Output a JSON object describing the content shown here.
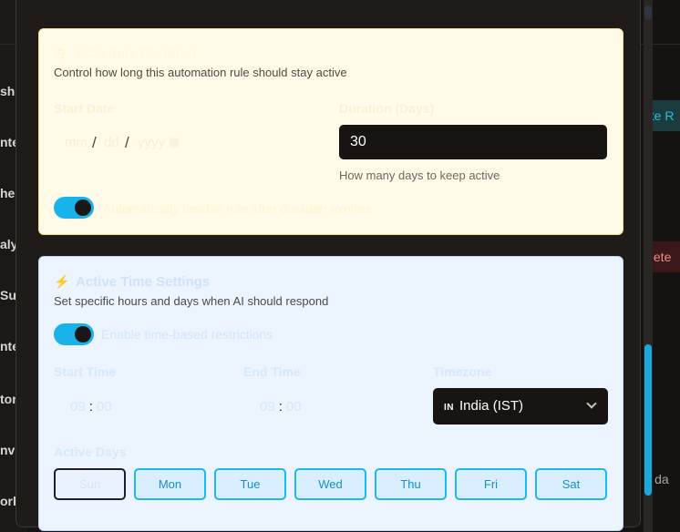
{
  "background": {
    "sidebar_labels": [
      "sh",
      "nte",
      "he",
      "aly",
      "Su",
      "nte",
      "tor",
      "nv",
      "ork"
    ],
    "create_button": "ate R",
    "delete_button": "elete",
    "right_text": "ll da"
  },
  "schedule": {
    "title": "Schedule Duration",
    "description": "Control how long this automation rule should stay active",
    "start_date_label": "Start Date",
    "date_placeholder": {
      "month": "mm",
      "day": "dd",
      "year": "yyyy"
    },
    "duration_label": "Duration (Days)",
    "duration_value": "30",
    "duration_helper": "How many days to keep active",
    "toggle_label": "Automatically disable rule after duration expires",
    "toggle_on": true
  },
  "active_time": {
    "title": "Active Time Settings",
    "description": "Set specific hours and days when AI should respond",
    "toggle_label": "Enable time-based restrictions",
    "toggle_on": true,
    "start_time_label": "Start Time",
    "start_time": {
      "hour": "09",
      "minute": "00"
    },
    "end_time_label": "End Time",
    "end_time": {
      "hour": "09",
      "minute": "00"
    },
    "timezone_label": "Timezone",
    "timezone_flag": "IN",
    "timezone_value": "India (IST)",
    "days_label": "Active Days",
    "days": [
      "Sun",
      "Mon",
      "Tue",
      "Wed",
      "Thu",
      "Fri",
      "Sat"
    ]
  },
  "colors": {
    "accent": "#19b3ea",
    "schedule_card_bg": "#fffbe8",
    "time_card_bg": "#ebf4ff",
    "dark_input": "#171412"
  }
}
